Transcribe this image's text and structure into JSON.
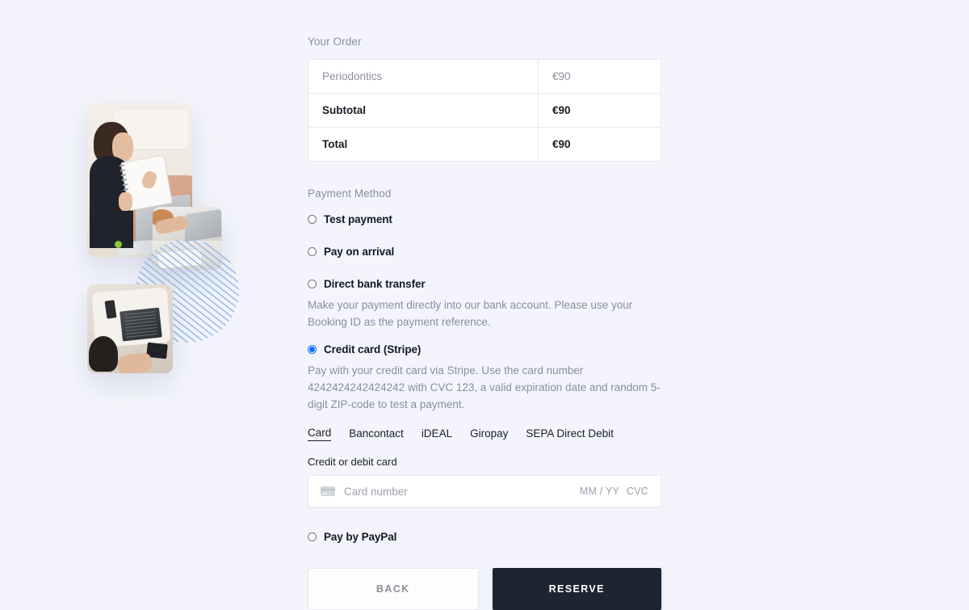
{
  "theme": {
    "page_background": "#f4f5fc",
    "accent_blue": "#0d6efd",
    "accent_green": "#8cc63f",
    "reserve_button_bg": "#1e2532",
    "muted_text": "#8a8f99"
  },
  "order": {
    "label": "Your Order",
    "rows": [
      {
        "name": "Periodontics",
        "amount": "€90",
        "kind": "item"
      },
      {
        "name": "Subtotal",
        "amount": "€90",
        "kind": "sum"
      },
      {
        "name": "Total",
        "amount": "€90",
        "kind": "sum"
      }
    ]
  },
  "payment": {
    "label": "Payment Method",
    "options": [
      {
        "title": "Test payment",
        "selected": false,
        "description": ""
      },
      {
        "title": "Pay on arrival",
        "selected": false,
        "description": ""
      },
      {
        "title": "Direct bank transfer",
        "selected": false,
        "description": "Make your payment directly into our bank account. Please use your Booking ID as the payment reference."
      },
      {
        "title": "Credit card (Stripe)",
        "selected": true,
        "description": "Pay with your credit card via Stripe. Use the card number 4242424242424242 with CVC 123, a valid expiration date and random 5-digit ZIP-code to test a payment."
      },
      {
        "title": "Pay by PayPal",
        "selected": false,
        "description": ""
      }
    ],
    "stripe": {
      "tabs": [
        {
          "label": "Card",
          "active": true
        },
        {
          "label": "Bancontact",
          "active": false
        },
        {
          "label": "iDEAL",
          "active": false
        },
        {
          "label": "Giropay",
          "active": false
        },
        {
          "label": "SEPA Direct Debit",
          "active": false
        }
      ],
      "field_label": "Credit or debit card",
      "card_number_placeholder": "Card number",
      "expiry_placeholder": "MM / YY",
      "cvc_placeholder": "CVC",
      "card_number_value": "",
      "card_icon": "credit-card-icon"
    }
  },
  "actions": {
    "back_label": "BACK",
    "reserve_label": "RESERVE"
  }
}
